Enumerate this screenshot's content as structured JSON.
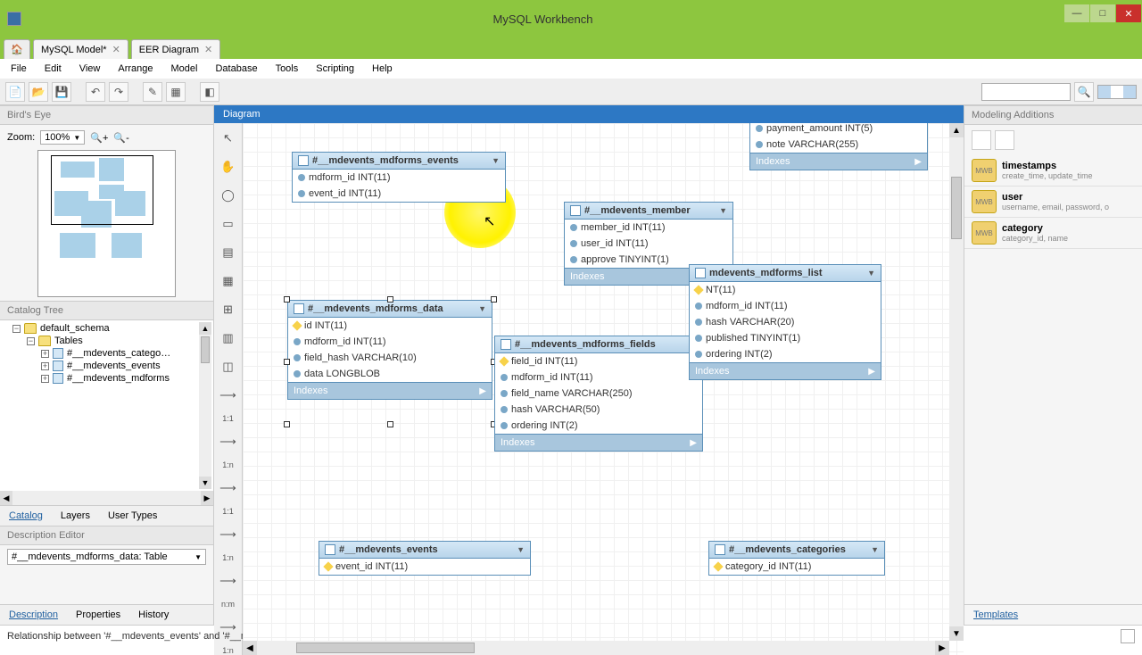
{
  "app_title": "MySQL Workbench",
  "tabs": [
    "MySQL Model*",
    "EER Diagram"
  ],
  "menu": [
    "File",
    "Edit",
    "View",
    "Arrange",
    "Model",
    "Database",
    "Tools",
    "Scripting",
    "Help"
  ],
  "birds_eye": "Bird's Eye",
  "zoom_label": "Zoom:",
  "zoom_value": "100%",
  "catalog_tree": "Catalog Tree",
  "schema": "default_schema",
  "tables_label": "Tables",
  "tree_items": [
    "#__mdevents_catego…",
    "#__mdevents_events",
    "#__mdevents_mdforms"
  ],
  "catalog_tabs": [
    "Catalog",
    "Layers",
    "User Types"
  ],
  "desc_editor": "Description Editor",
  "desc_sel": "#__mdevents_mdforms_data: Table",
  "desc_tabs": [
    "Description",
    "Properties",
    "History"
  ],
  "diagram": "Diagram",
  "modeling_additions": "Modeling Additions",
  "templates": [
    {
      "name": "timestamps",
      "sub": "create_time, update_time"
    },
    {
      "name": "user",
      "sub": "username, email, password, o"
    },
    {
      "name": "category",
      "sub": "category_id, name"
    }
  ],
  "templates_tab": "Templates",
  "tool_labels": {
    "l11": "1:1",
    "l1n_a": "1:n",
    "l11_b": "1:1",
    "l1n_b": "1:n",
    "lnm": "n:m",
    "l1n_c": "1:n"
  },
  "tables": {
    "events": {
      "title": "#__mdevents_mdforms_events",
      "cols": [
        "mdform_id INT(11)",
        "event_id INT(11)"
      ]
    },
    "member": {
      "title": "#__mdevents_member",
      "cols": [
        "member_id INT(11)",
        "user_id INT(11)",
        "approve TINYINT(1)"
      ],
      "idx": "Indexes"
    },
    "data": {
      "title": "#__mdevents_mdforms_data",
      "cols": [
        "id INT(11)",
        "mdform_id INT(11)",
        "field_hash VARCHAR(10)",
        "data LONGBLOB"
      ],
      "idx": "Indexes"
    },
    "fields": {
      "title": "#__mdevents_mdforms_fields",
      "cols": [
        "field_id INT(11)",
        "mdform_id INT(11)",
        "field_name VARCHAR(250)",
        "hash VARCHAR(50)",
        "ordering INT(2)"
      ],
      "idx": "Indexes"
    },
    "list": {
      "title": "mdevents_mdforms_list",
      "cols": [
        "NT(11)",
        "mdform_id INT(11)",
        "hash VARCHAR(20)",
        "published TINYINT(1)",
        "ordering INT(2)"
      ],
      "idx": "Indexes"
    },
    "top": {
      "cols": [
        "payment_amount INT(5)",
        "note VARCHAR(255)"
      ],
      "idx": "Indexes"
    },
    "ev2": {
      "title": "#__mdevents_events",
      "cols": [
        "event_id INT(11)"
      ]
    },
    "cat": {
      "title": "#__mdevents_categories",
      "cols": [
        "category_id INT(11)"
      ]
    }
  },
  "indexes_label": "Indexes",
  "status": "Relationship between '#__mdevents_events' and '#__mdevents_categories' created."
}
